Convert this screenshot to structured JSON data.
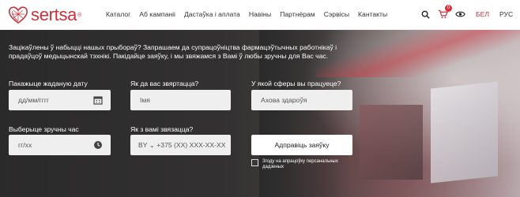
{
  "brand": {
    "name": "sertsa",
    "reg": "®"
  },
  "nav": [
    "Каталог",
    "Аб кампаніі",
    "Дастаўка і аплата",
    "Навіны",
    "Партнёрам",
    "Сэрвісы",
    "Кантакты"
  ],
  "header": {
    "cart_count": "0",
    "lang_active": "БЕЛ",
    "lang_other": "РУС"
  },
  "hero": {
    "intro": "Зацікаўлены ў набыцці нашых прыбораў? Запрашаем да супрацоўніцтва фармацэўтычных работнікаў і прадаўцоў медыцынскай тэхнікі. Пакідайце заяўку, і мы звяжамся з Вамі ў любы зручны для Вас час.",
    "date_label": "Пакажыце жаданую дату",
    "date_placeholder": "дд/мм/гггг",
    "name_label": "Як да вас звяртацца?",
    "name_placeholder": "Імя",
    "sphere_label": "У якой сферы вы працуеце?",
    "sphere_value": "Ахова здароўя",
    "time_label": "Выберыце зручны час",
    "time_placeholder": "гг/хх",
    "contact_label": "Як з вамі звязацца?",
    "contact_placeholder": "BY ⌄ +375 (XX) XXX-XX-XX",
    "submit_label": "Адправіць заяўку",
    "consent": "Згоду на апрацоўку персанальных дадзеных"
  },
  "colors": {
    "brand": "#c8313b",
    "badge": "#d9303c"
  }
}
